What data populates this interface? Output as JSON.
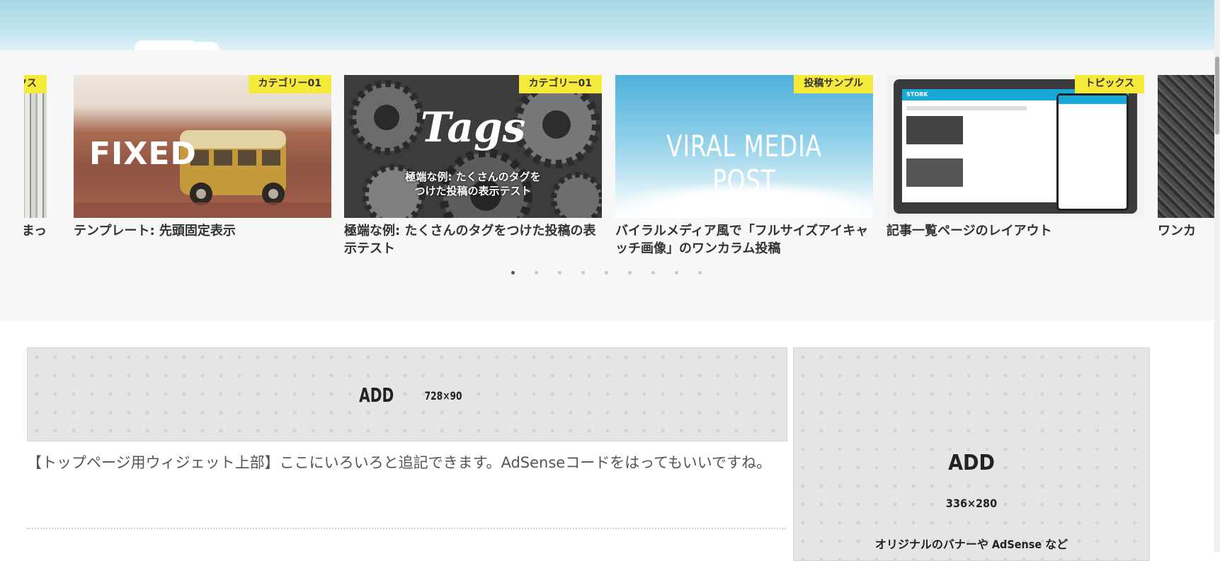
{
  "slider": {
    "cards": [
      {
        "category": "トピックス",
        "title": "まっ",
        "thumb": "wood"
      },
      {
        "category": "カテゴリー01",
        "title": "テンプレート: 先頭固定表示",
        "thumb": "fixed",
        "thumb_text": "FIXED"
      },
      {
        "category": "カテゴリー01",
        "title": "極端な例: たくさんのタグをつけた投稿の表示テスト",
        "thumb": "gears",
        "thumb_text": "Tags",
        "thumb_caption_line1": "極端な例: たくさんのタグを",
        "thumb_caption_line2": "つけた投稿の表示テスト"
      },
      {
        "category": "投稿サンプル",
        "title": "バイラルメディア風で「フルサイズアイキャッチ画像」のワンカラム投稿",
        "thumb": "viral",
        "thumb_text": "VIRAL MEDIA POST"
      },
      {
        "category": "トピックス",
        "title": "記事一覧ページのレイアウト",
        "thumb": "laptop",
        "thumb_text": "STORK"
      },
      {
        "category": "",
        "title": "ワンカ",
        "thumb": "dark"
      }
    ],
    "dots_total": 9,
    "dots_active": 0
  },
  "ads": {
    "top_add": "ADD",
    "top_size": "728×90",
    "side_add": "ADD",
    "side_size": "336×280",
    "side_caption": "オリジナルのバナーや AdSense など"
  },
  "widget": {
    "text": "【トップページ用ウィジェット上部】ここにいろいろと追記できます。AdSenseコードをはってもいいですね。"
  },
  "colors": {
    "category_badge": "#f5ea3a",
    "band_bg": "#f7f7f7"
  }
}
